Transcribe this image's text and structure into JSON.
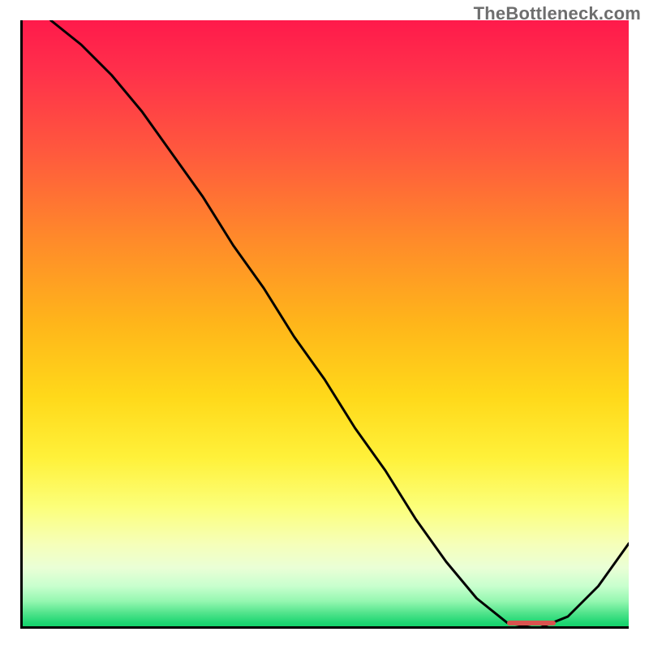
{
  "attribution": "TheBottleneck.com",
  "chart_data": {
    "type": "line",
    "title": "",
    "xlabel": "",
    "ylabel": "",
    "xlim": [
      0,
      100
    ],
    "ylim": [
      0,
      100
    ],
    "x": [
      5,
      10,
      15,
      20,
      25,
      30,
      35,
      40,
      45,
      50,
      55,
      60,
      65,
      70,
      75,
      80,
      85,
      90,
      95,
      100
    ],
    "values": [
      100,
      96,
      91,
      85,
      78,
      71,
      63,
      56,
      48,
      41,
      33,
      26,
      18,
      11,
      5,
      1,
      0,
      2,
      7,
      14
    ],
    "flat_region_x": [
      80,
      88
    ],
    "gradient_stops": [
      {
        "pos": 0,
        "color": "#ff1a4b"
      },
      {
        "pos": 0.5,
        "color": "#ffd91a"
      },
      {
        "pos": 0.85,
        "color": "#fcff7a"
      },
      {
        "pos": 1.0,
        "color": "#10cf66"
      }
    ]
  }
}
